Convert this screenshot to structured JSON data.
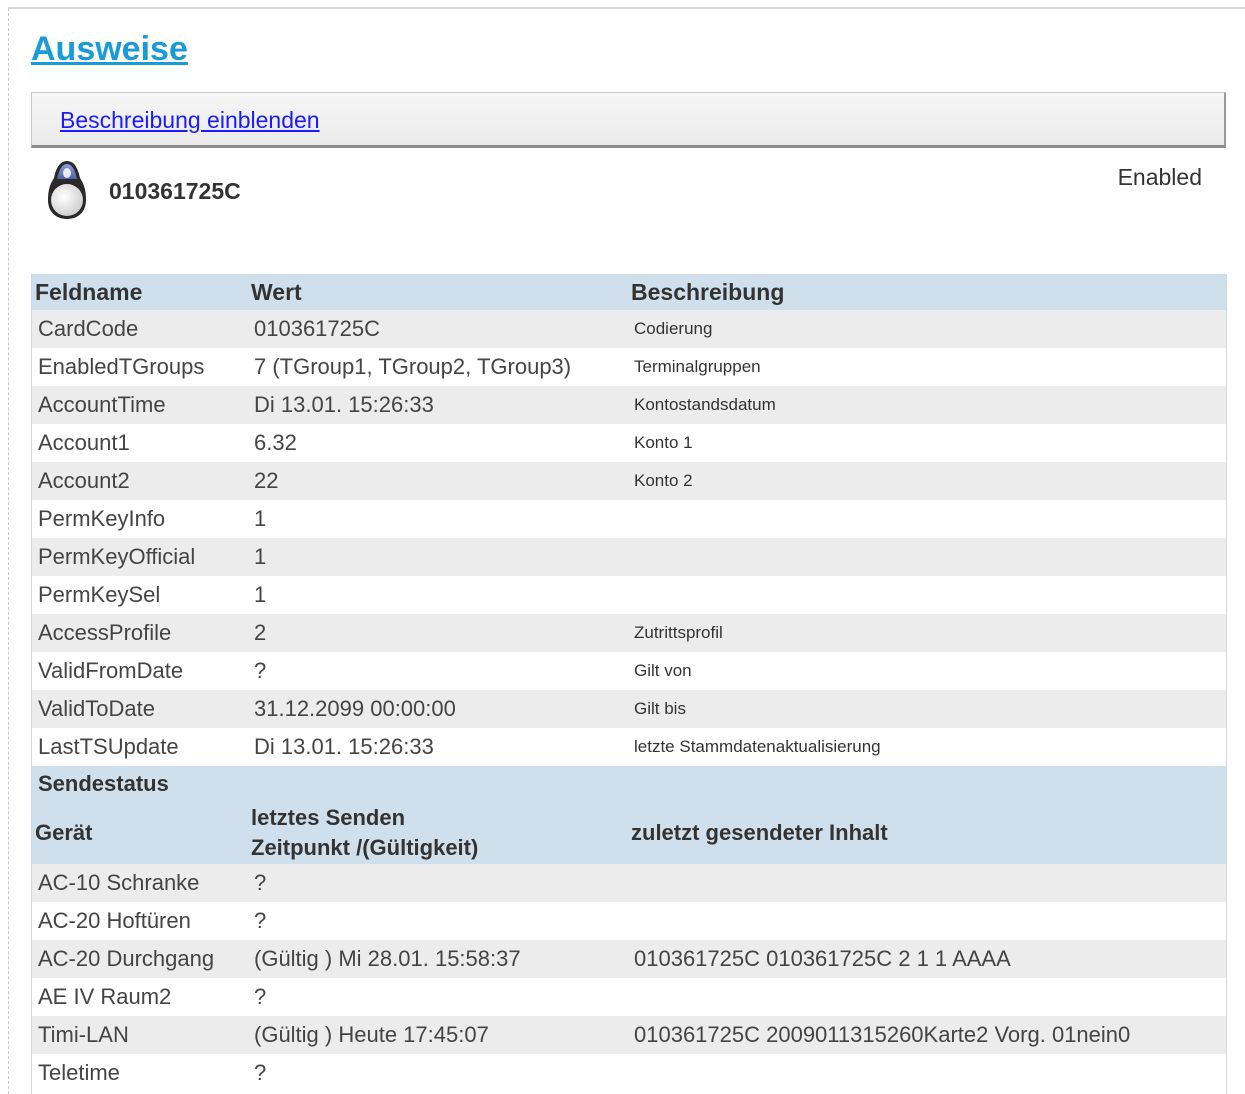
{
  "page": {
    "title": "Ausweise",
    "description_link": "Beschreibung einblenden"
  },
  "card": {
    "code": "010361725C",
    "status": "Enabled",
    "icon": "key-fob-icon"
  },
  "fields_table": {
    "headers": [
      "Feldname",
      "Wert",
      "Beschreibung"
    ],
    "rows": [
      [
        "CardCode",
        "010361725C",
        "Codierung"
      ],
      [
        "EnabledTGroups",
        "7 (TGroup1, TGroup2, TGroup3)",
        "Terminalgruppen"
      ],
      [
        "AccountTime",
        "Di 13.01. 15:26:33",
        "Kontostandsdatum"
      ],
      [
        "Account1",
        "6.32",
        "Konto 1"
      ],
      [
        "Account2",
        "22",
        "Konto 2"
      ],
      [
        "PermKeyInfo",
        "1",
        ""
      ],
      [
        "PermKeyOfficial",
        "1",
        ""
      ],
      [
        "PermKeySel",
        "1",
        ""
      ],
      [
        "AccessProfile",
        "2",
        "Zutrittsprofil"
      ],
      [
        "ValidFromDate",
        "?",
        "Gilt von"
      ],
      [
        "ValidToDate",
        "31.12.2099 00:00:00",
        "Gilt bis"
      ],
      [
        "LastTSUpdate",
        "Di 13.01. 15:26:33",
        "letzte Stammdatenaktualisierung"
      ]
    ]
  },
  "send_table": {
    "section_title": "Sendestatus",
    "headers": [
      "Gerät",
      "letztes Senden",
      "Zeitpunkt /(Gültigkeit)",
      "zuletzt gesendeter Inhalt"
    ],
    "rows": [
      [
        "AC-10 Schranke",
        "?",
        ""
      ],
      [
        "AC-20 Hoftüren",
        "?",
        ""
      ],
      [
        "AC-20 Durchgang",
        "(Gültig ) Mi 28.01. 15:58:37",
        "010361725C 010361725C 2 1 1 AAAA"
      ],
      [
        "AE IV Raum2",
        "?",
        ""
      ],
      [
        "Timi-LAN",
        "(Gültig ) Heute 17:45:07",
        "010361725C 2009011315260Karte2 Vorg. 01nein0"
      ],
      [
        "Teletime",
        "?",
        ""
      ]
    ]
  }
}
